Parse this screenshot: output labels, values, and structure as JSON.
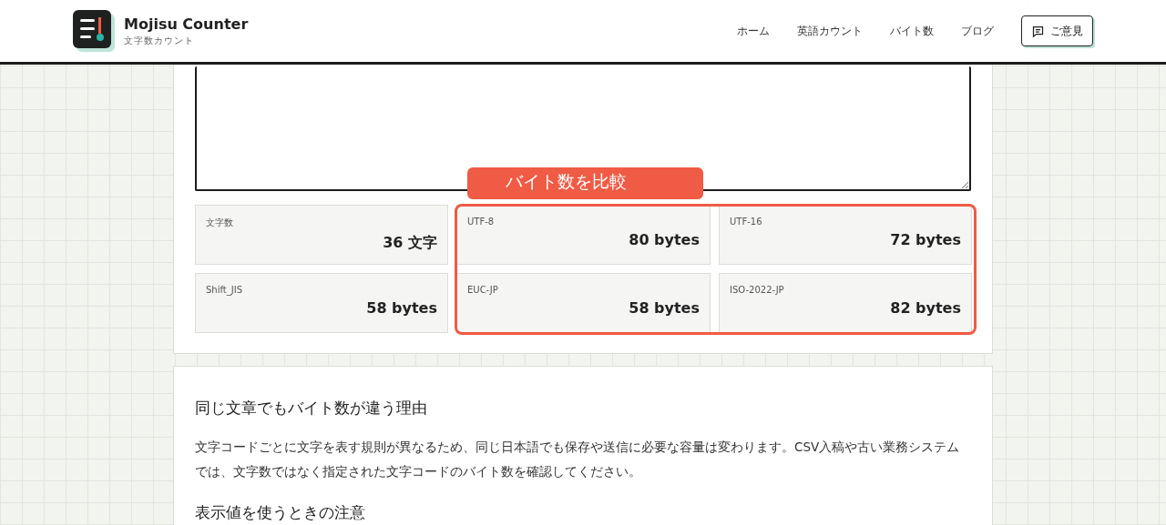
{
  "header": {
    "title": "Mojisu Counter",
    "subtitle": "文字数カウント",
    "nav": [
      "ホーム",
      "英語カウント",
      "バイト数",
      "ブログ"
    ],
    "feedback_button": "ご意見"
  },
  "compare_label": "バイト数を比較",
  "stats": [
    {
      "label": "文字数",
      "value": "36 文字"
    },
    {
      "label": "UTF-8",
      "value": "80 bytes"
    },
    {
      "label": "UTF-16",
      "value": "72 bytes"
    },
    {
      "label": "Shift_JIS",
      "value": "58 bytes"
    },
    {
      "label": "EUC-JP",
      "value": "58 bytes"
    },
    {
      "label": "ISO-2022-JP",
      "value": "82 bytes"
    }
  ],
  "article": [
    {
      "kind": "heading",
      "text": "同じ文章でもバイト数が違う理由"
    },
    {
      "kind": "paragraph",
      "text": "文字コードごとに文字を表す規則が異なるため、同じ日本語でも保存や送信に必要な容量は変わります。CSV入稿や古い業務システムでは、文字数ではなく指定された文字コードのバイト数を確認してください。"
    },
    {
      "kind": "heading",
      "text": "表示値を使うときの注意"
    }
  ]
}
